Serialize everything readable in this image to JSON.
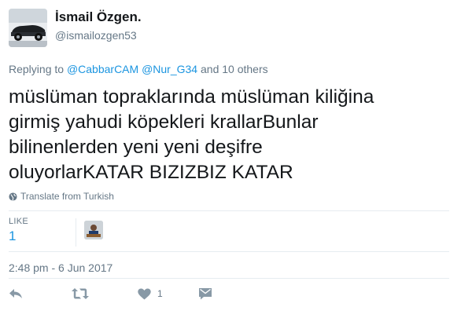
{
  "author": {
    "display_name": "İsmail Özgen.",
    "username": "@ismailozgen53",
    "avatar_icon": "vintage-car-avatar"
  },
  "reply_context": {
    "prefix": "Replying to",
    "mentions": [
      "@CabbarCAM",
      "@Nur_G34"
    ],
    "suffix": "and 10 others"
  },
  "tweet": {
    "text": "müslüman topraklarında müslüman kiliğina\ngirmiş yahudi köpekleri krallarBunlar\nbilinenlerden yeni yeni deşifre\noluyorlarKATAR BIZIZBIZ KATAR"
  },
  "translate": {
    "label": "Translate from Turkish",
    "icon": "globe-icon"
  },
  "stats": {
    "likes_label": "LIKE",
    "likes_count": "1"
  },
  "timestamp": "2:48 pm - 6 Jun 2017",
  "actions": {
    "reply_icon": "reply-icon",
    "retweet_icon": "retweet-icon",
    "like_icon": "heart-icon",
    "like_count": "1",
    "dm_icon": "envelope-icon"
  },
  "colors": {
    "link": "#1b95e0",
    "secondary_text": "#657786",
    "primary_text": "#14171a",
    "icon": "#8899a6"
  }
}
